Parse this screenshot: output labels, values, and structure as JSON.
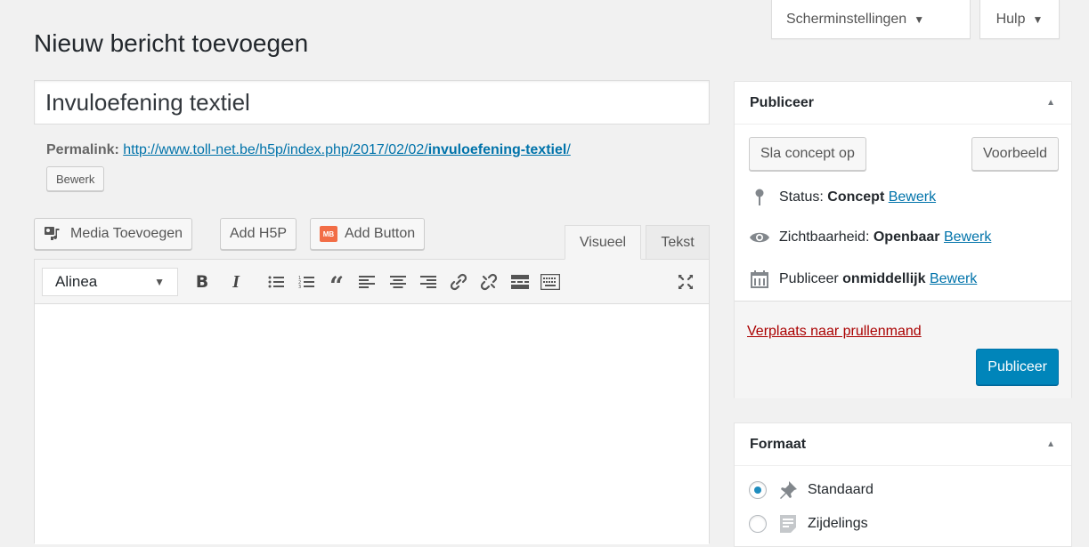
{
  "screen_meta": {
    "screen_options_label": "Scherminstellingen",
    "help_label": "Hulp"
  },
  "page": {
    "title": "Nieuw bericht toevoegen"
  },
  "post": {
    "title_value": "Invuloefening textiel",
    "permalink_label": "Permalink:",
    "permalink_base": "http://www.toll-net.be/h5p/index.php/2017/02/02/",
    "permalink_slug": "invuloefening-textiel",
    "permalink_trailing": "/",
    "edit_slug_label": "Bewerk"
  },
  "media_buttons": {
    "add_media": "Media Toevoegen",
    "add_h5p": "Add H5P",
    "add_button": "Add Button",
    "mb_badge": "MB"
  },
  "editor": {
    "tab_visual": "Visueel",
    "tab_text": "Tekst",
    "format_value": "Alinea",
    "content": ""
  },
  "publish_box": {
    "title": "Publiceer",
    "save_draft": "Sla concept op",
    "preview": "Voorbeeld",
    "status_label": "Status:",
    "status_value": "Concept",
    "status_edit": "Bewerk",
    "visibility_label": "Zichtbaarheid:",
    "visibility_value": "Openbaar",
    "visibility_edit": "Bewerk",
    "schedule_label": "Publiceer",
    "schedule_value": "onmiddellijk",
    "schedule_edit": "Bewerk",
    "trash_link": "Verplaats naar prullenmand",
    "publish_button": "Publiceer"
  },
  "format_box": {
    "title": "Formaat",
    "options": [
      {
        "label": "Standaard",
        "selected": true
      },
      {
        "label": "Zijdelings",
        "selected": false
      }
    ]
  },
  "colors": {
    "link": "#0073aa",
    "primary": "#0085ba",
    "trash": "#aa0000",
    "radio_selected": "#1e8cbe"
  },
  "icons": {
    "screen_options_caret": "caret-down-icon",
    "help_caret": "caret-down-icon",
    "add_media": "media-icon",
    "add_button": "mb-badge-icon",
    "status": "pin-icon",
    "visibility": "eye-icon",
    "schedule": "calendar-icon",
    "format_standard": "thumbtack-icon",
    "format_aside": "aside-icon"
  }
}
